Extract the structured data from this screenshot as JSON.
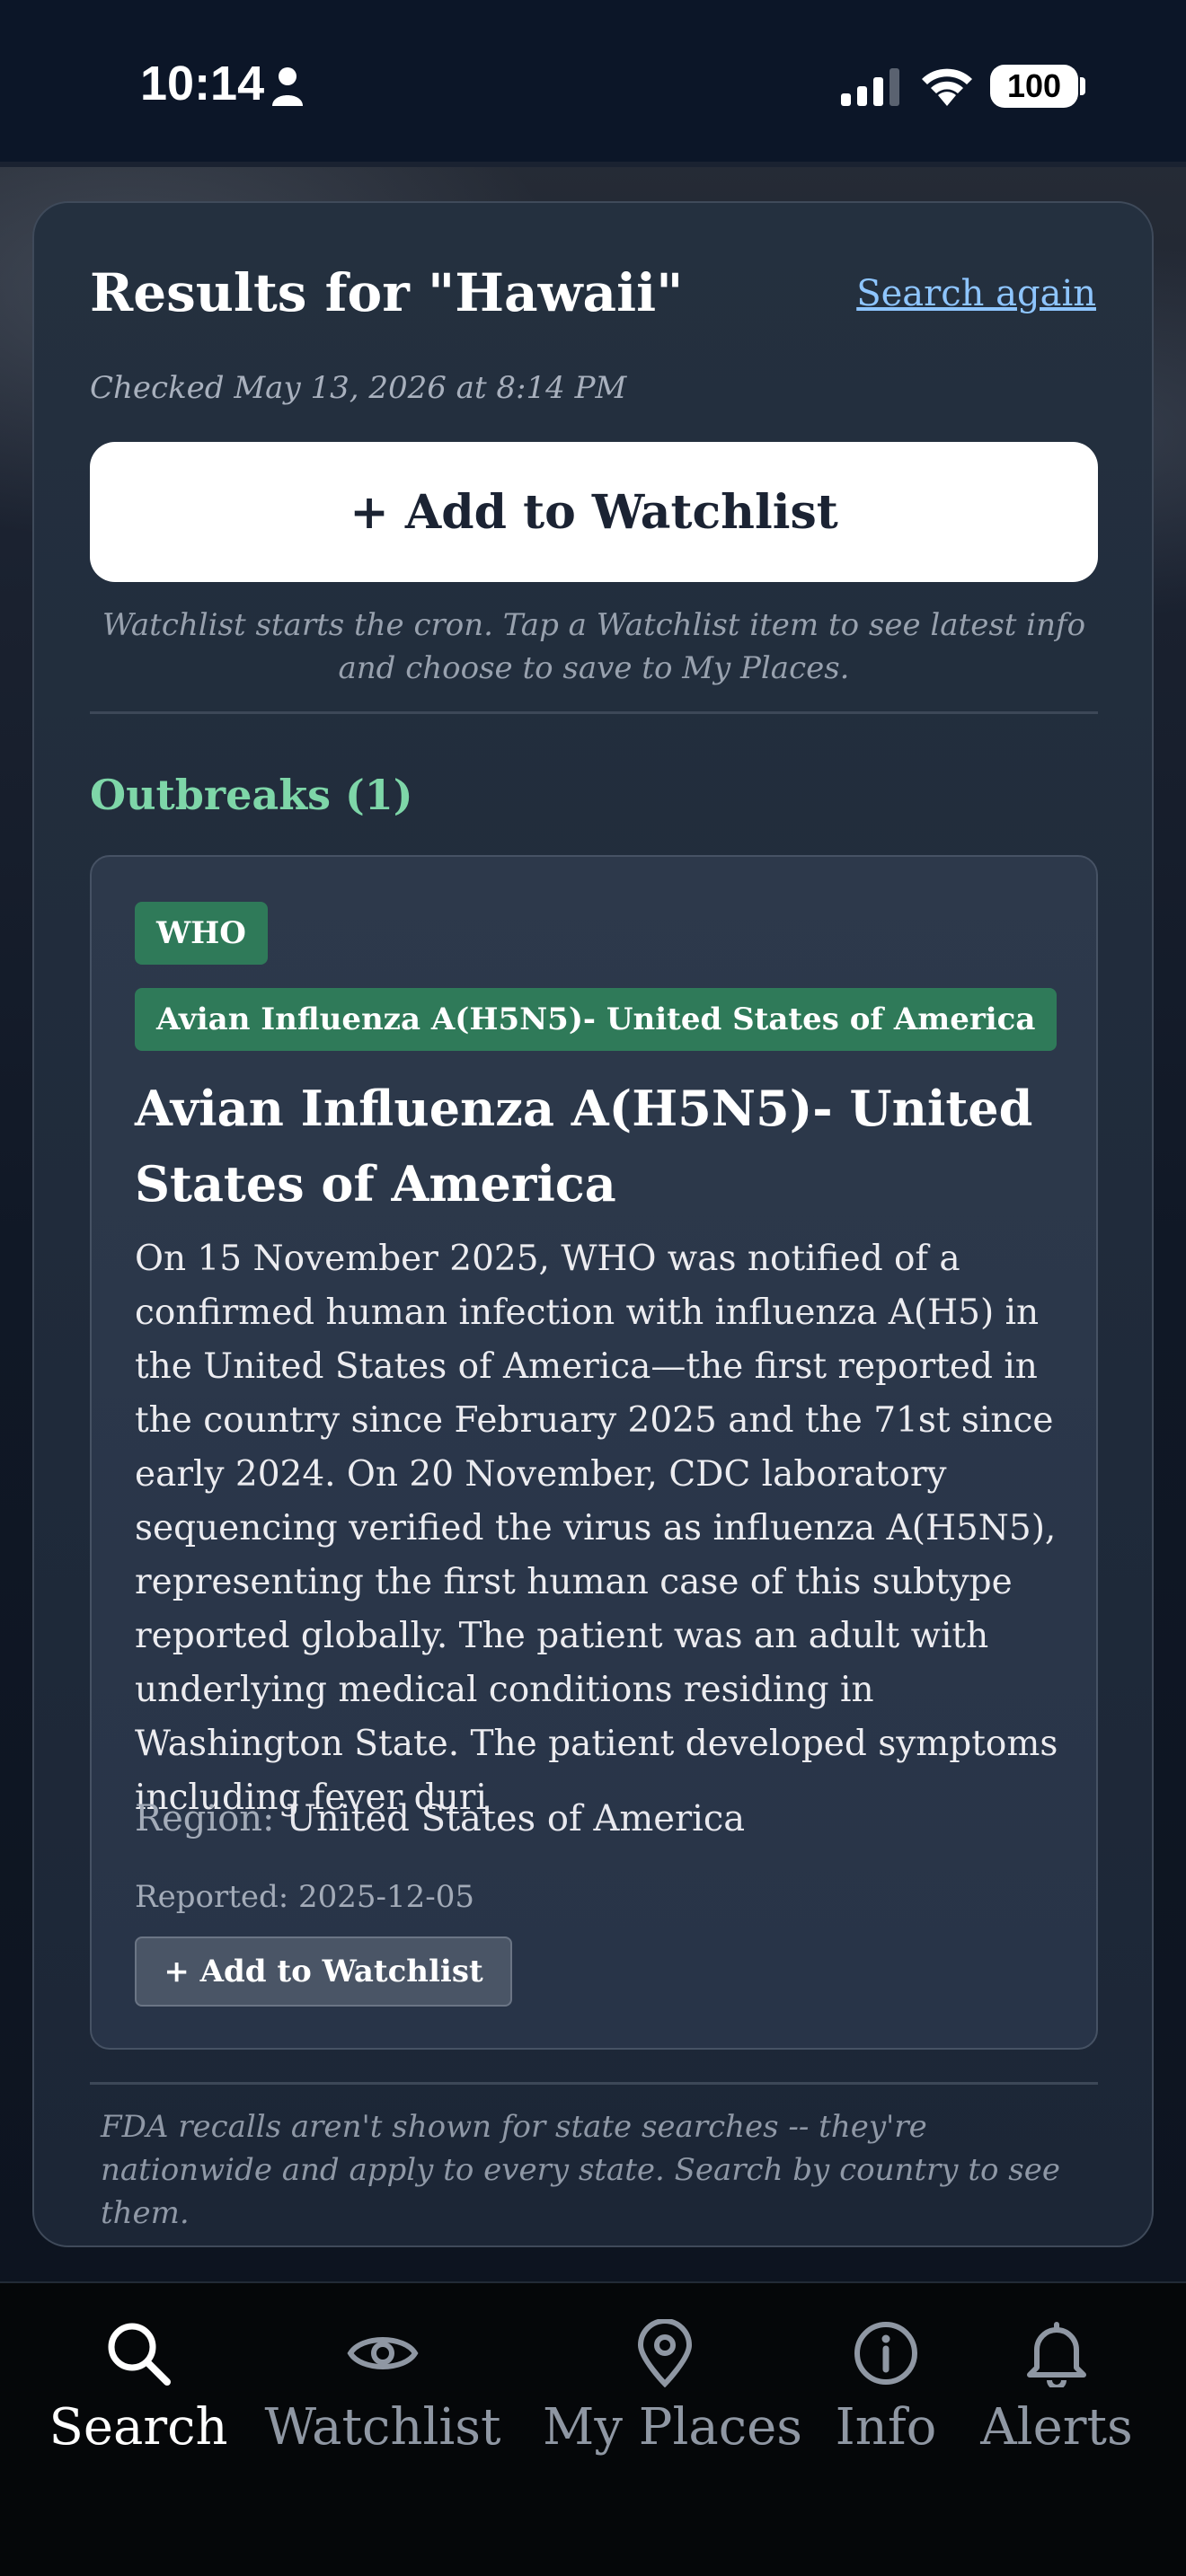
{
  "status_bar": {
    "time": "10:14",
    "battery": "100"
  },
  "results": {
    "title": "Results for \"Hawaii\"",
    "search_again": "Search again",
    "checked": "Checked May 13, 2026 at 8:14 PM",
    "add_watchlist": "+ Add to Watchlist",
    "watchlist_note": "Watchlist starts the cron. Tap a Watchlist item to see latest info and choose to save to My Places."
  },
  "outbreaks": {
    "heading": "Outbreaks (1)",
    "items": [
      {
        "source": "WHO",
        "tag_title": "Avian Influenza A(H5N5)- United States of America",
        "title": "Avian Influenza A(H5N5)- United States of America",
        "body": "On 15 November 2025, WHO was notified of a confirmed human infection with influenza A(H5) in the United States of America—the first reported in the country since February 2025 and the 71st since early 2024. On 20 November, CDC laboratory sequencing verified the virus as influenza A(H5N5), representing the first human case of this subtype reported globally. The patient was an adult with underlying medical conditions residing in Washington State. The patient developed symptoms including fever duri",
        "region_label": "Region:",
        "region": "United States of America",
        "reported": "Reported: 2025-12-05",
        "add_watchlist": "+ Add to Watchlist"
      }
    ]
  },
  "fda_note": "FDA recalls aren't shown for state searches -- they're nationwide and apply to every state. Search by country to see them.",
  "nav": {
    "items": [
      {
        "label": "Search",
        "icon": "search-icon",
        "active": true
      },
      {
        "label": "Watchlist",
        "icon": "eye-icon",
        "active": false
      },
      {
        "label": "My Places",
        "icon": "map-pin-icon",
        "active": false
      },
      {
        "label": "Info",
        "icon": "info-icon",
        "active": false
      },
      {
        "label": "Alerts",
        "icon": "bell-icon",
        "active": false
      }
    ]
  },
  "colors": {
    "accent_green": "#7ed6a8",
    "tag_green": "#2f7a59",
    "link_blue": "#8ec5ff"
  }
}
